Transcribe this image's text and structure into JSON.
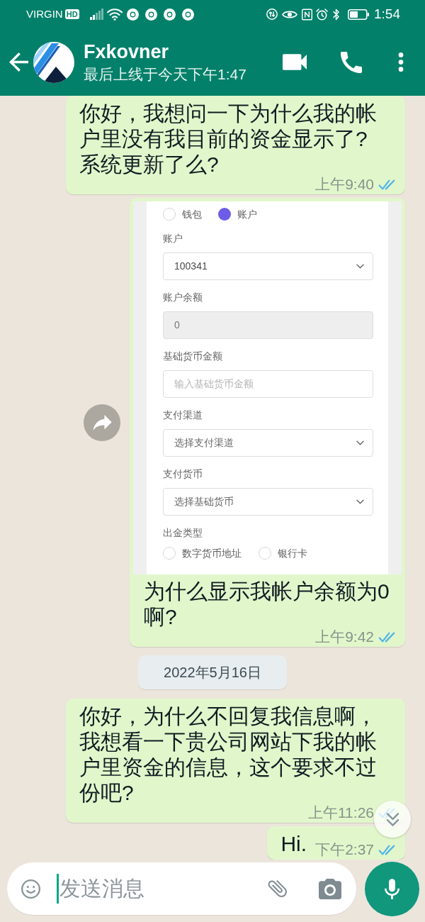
{
  "status_bar": {
    "carrier": "VIRGIN",
    "carrier_badge": "HD",
    "time": "1:54"
  },
  "header": {
    "name": "Fxkovner",
    "last_seen": "最后上线于今天下午1:47"
  },
  "messages": [
    {
      "kind": "text",
      "text": "你好，我想问一下为什么我的帐户里没有我目前的资金显示了?系统更新了么?",
      "time": "上午9:40",
      "read": true
    },
    {
      "kind": "image",
      "form": {
        "source_options": [
          {
            "label": "钱包",
            "selected": false
          },
          {
            "label": "账户",
            "selected": true
          }
        ],
        "fields": [
          {
            "kind": "select",
            "label": "账户",
            "value": "100341",
            "disabled": false
          },
          {
            "kind": "input",
            "label": "账户余额",
            "value": "0",
            "disabled": true
          },
          {
            "kind": "input",
            "label": "基础货币金额",
            "placeholder": "输入基础货币金额",
            "disabled": false
          },
          {
            "kind": "select",
            "label": "支付渠道",
            "placeholder": "选择支付渠道",
            "disabled": false
          },
          {
            "kind": "select",
            "label": "支付货币",
            "placeholder": "选择基础货币",
            "disabled": false
          },
          {
            "kind": "radio",
            "label": "出金类型",
            "options": [
              {
                "label": "数字货币地址",
                "selected": false
              },
              {
                "label": "银行卡",
                "selected": false
              }
            ],
            "disabled": false
          }
        ]
      },
      "caption": "为什么显示我帐户余额为0啊?",
      "time": "上午9:42",
      "read": true
    },
    {
      "kind": "date",
      "text": "2022年5月16日"
    },
    {
      "kind": "text",
      "text": "你好，为什么不回复我信息啊，我想看一下贵公司网站下我的帐户里资金的信息，这个要求不过份吧?",
      "time": "上午11:26",
      "read": true
    },
    {
      "kind": "text",
      "text": "Hi.",
      "time": "下午2:37",
      "read": true
    }
  ],
  "composer": {
    "placeholder": "发送消息"
  }
}
